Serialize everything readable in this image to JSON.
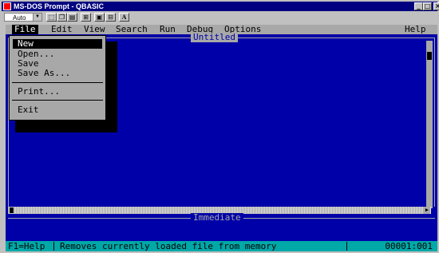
{
  "window": {
    "title": "MS-DOS Prompt - QBASIC",
    "min_glyph": "_",
    "max_glyph": "□",
    "close_glyph": "×"
  },
  "toolbar": {
    "font_size_value": "Auto",
    "font_button_label": "A"
  },
  "menubar": {
    "items": [
      "File",
      "Edit",
      "View",
      "Search",
      "Run",
      "Debug",
      "Options",
      "Help"
    ]
  },
  "editor": {
    "title": "Untitled"
  },
  "file_menu": {
    "items": [
      "New",
      "Open...",
      "Save",
      "Save As...",
      "Print...",
      "Exit"
    ],
    "highlighted": "New"
  },
  "immediate": {
    "title": "Immediate"
  },
  "statusbar": {
    "help": "F1=Help",
    "message": "Removes currently loaded file from memory",
    "position": "00001:001"
  },
  "colors": {
    "dos_blue": "#0000a8",
    "menu_gray": "#a8a8a8",
    "status_cyan": "#00a8a8",
    "titlebar_navy": "#000080"
  }
}
